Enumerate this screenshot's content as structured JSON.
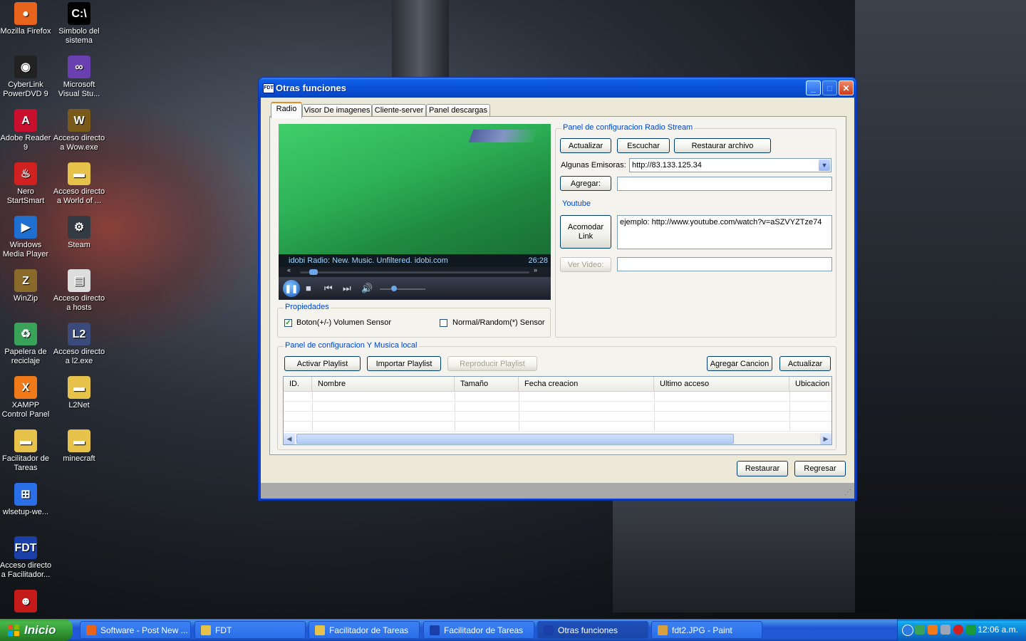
{
  "desktop": {
    "icons": [
      {
        "label": "Mozilla Firefox",
        "color": "#e8631c",
        "glyph": "●",
        "icon": "firefox-icon"
      },
      {
        "label": "Simbolo del sistema",
        "color": "#000000",
        "glyph": "C:\\",
        "icon": "cmd-icon"
      },
      {
        "label": "CyberLink PowerDVD 9",
        "color": "#222222",
        "glyph": "◉",
        "icon": "powerdvd-icon"
      },
      {
        "label": "Microsoft Visual Stu...",
        "color": "#6a3fb0",
        "glyph": "∞",
        "icon": "visual-studio-icon"
      },
      {
        "label": "Adobe Reader 9",
        "color": "#c8102e",
        "glyph": "A",
        "icon": "adobe-reader-icon"
      },
      {
        "label": "Acceso directo a Wow.exe",
        "color": "#7a5a1a",
        "glyph": "W",
        "icon": "wow-icon"
      },
      {
        "label": "Nero StartSmart",
        "color": "#d02020",
        "glyph": "♨",
        "icon": "nero-icon"
      },
      {
        "label": "Acceso directo a World of ...",
        "color": "#e6c24a",
        "glyph": "▬",
        "icon": "folder-icon"
      },
      {
        "label": "Windows Media Player",
        "color": "#1f6fd1",
        "glyph": "▶",
        "icon": "media-player-icon"
      },
      {
        "label": "Steam",
        "color": "#333a44",
        "glyph": "⚙",
        "icon": "steam-icon"
      },
      {
        "label": "WinZip",
        "color": "#8a6a2a",
        "glyph": "Z",
        "icon": "winzip-icon"
      },
      {
        "label": "Acceso directo a hosts",
        "color": "#dddddd",
        "glyph": "▤",
        "icon": "hosts-file-icon"
      },
      {
        "label": "Papelera de reciclaje",
        "color": "#3aa35a",
        "glyph": "♻",
        "icon": "recycle-bin-icon"
      },
      {
        "label": "Acceso directo a l2.exe",
        "color": "#3a4a7a",
        "glyph": "L2",
        "icon": "l2-icon"
      },
      {
        "label": "XAMPP Control Panel",
        "color": "#f07a1a",
        "glyph": "X",
        "icon": "xampp-icon"
      },
      {
        "label": "L2Net",
        "color": "#e6c24a",
        "glyph": "▬",
        "icon": "folder-icon"
      },
      {
        "label": "Facilitador de Tareas",
        "color": "#e6c24a",
        "glyph": "▬",
        "icon": "folder-icon"
      },
      {
        "label": "minecraft",
        "color": "#e6c24a",
        "glyph": "▬",
        "icon": "folder-icon"
      },
      {
        "label": "wlsetup-we...",
        "color": "#2a6ee8",
        "glyph": "⊞",
        "icon": "windows-flag-icon"
      },
      {
        "label": "",
        "color": "#000000",
        "glyph": "",
        "icon": "blank"
      },
      {
        "label": "Acceso directo a Facilitador...",
        "color": "#1a3fa8",
        "glyph": "FDT",
        "icon": "fdt-icon"
      },
      {
        "label": "",
        "color": "#000000",
        "glyph": "",
        "icon": "blank"
      },
      {
        "label": "",
        "color": "#c41a1a",
        "glyph": "☻",
        "icon": "red-app-icon"
      }
    ]
  },
  "window": {
    "title": "Otras funciones",
    "title_icon": "FDT",
    "tabs": [
      "Radio",
      "Visor De imagenes",
      "Cliente-server",
      "Panel descargas"
    ],
    "player": {
      "now_playing": "idobi Radio: New. Music. Unfiltered. idobi.com",
      "time": "26:28",
      "progress": 0.04,
      "volume": 0.25
    },
    "radio_panel": {
      "title": "Panel de configuracion Radio Stream",
      "actualizar": "Actualizar",
      "escuchar": "Escuchar",
      "restaurar_archivo": "Restaurar archivo",
      "emisoras_label": "Algunas Emisoras:",
      "emisoras_value": "http://83.133.125.34",
      "agregar": "Agregar:",
      "agregar_value": ""
    },
    "youtube": {
      "title": "Youtube",
      "acomodar": "Acomodar Link",
      "link_value": "ejemplo: http://www.youtube.com/watch?v=aSZVYZTze74",
      "ver_video": "Ver Video:",
      "ver_value": ""
    },
    "propiedades": {
      "title": "Propiedades",
      "check1": "Boton(+/-) Volumen Sensor",
      "check1_checked": true,
      "check2": "Normal/Random(*) Sensor",
      "check2_checked": false
    },
    "music_panel": {
      "title": "Panel de configuracion Y Musica local",
      "activar": "Activar Playlist",
      "importar": "Importar Playlist",
      "reproducir": "Reproducir Playlist",
      "agregar_cancion": "Agregar Cancion",
      "actualizar": "Actualizar",
      "columns": [
        "ID.",
        "Nombre",
        "Tamaño",
        "Fecha creacion",
        "Ultimo acceso",
        "Ubicacion"
      ]
    },
    "restaurar": "Restaurar",
    "regresar": "Regresar"
  },
  "taskbar": {
    "start": "Inicio",
    "tasks": [
      {
        "label": "Software - Post New ...",
        "icon": "firefox-icon",
        "color": "#e8631c",
        "active": false
      },
      {
        "label": "FDT",
        "icon": "folder-icon",
        "color": "#e6c24a",
        "active": false
      },
      {
        "label": "Facilitador de Tareas",
        "icon": "folder-icon",
        "color": "#e6c24a",
        "active": false
      },
      {
        "label": "Facilitador de Tareas",
        "icon": "fdt-icon",
        "color": "#1a3fa8",
        "active": false
      },
      {
        "label": "Otras funciones",
        "icon": "fdt-icon",
        "color": "#1a3fa8",
        "active": true
      },
      {
        "label": "fdt2.JPG - Paint",
        "icon": "paint-icon",
        "color": "#d8a040",
        "active": false
      }
    ],
    "clock": "12:06 a.m."
  }
}
